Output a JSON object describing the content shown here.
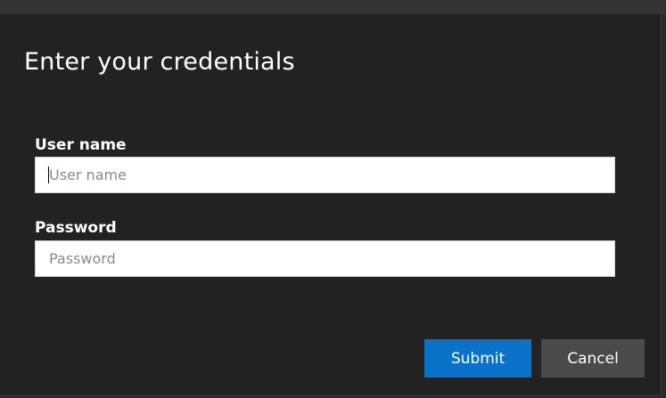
{
  "dialog": {
    "title": "Enter your credentials"
  },
  "fields": {
    "username": {
      "label": "User name",
      "placeholder": "User name",
      "value": ""
    },
    "password": {
      "label": "Password",
      "placeholder": "Password",
      "value": ""
    }
  },
  "buttons": {
    "submit_label": "Submit",
    "cancel_label": "Cancel"
  },
  "colors": {
    "background": "#222222",
    "accent": "#0a72c8",
    "secondary_button": "#4a4a4a"
  }
}
